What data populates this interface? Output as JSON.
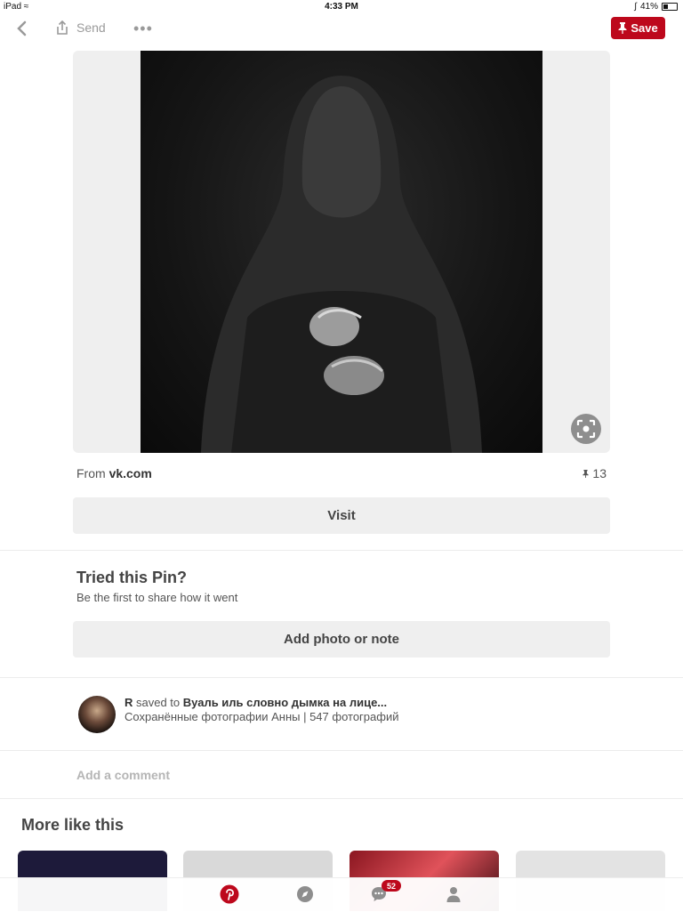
{
  "status_bar": {
    "device": "iPad",
    "time": "4:33 PM",
    "battery_percent": "41%"
  },
  "toolbar": {
    "send_label": "Send",
    "save_label": "Save"
  },
  "pin": {
    "source_prefix": "From ",
    "source_domain": "vk.com",
    "save_count": "13",
    "visit_label": "Visit"
  },
  "tried": {
    "title": "Tried this Pin?",
    "subtitle": "Be the first to share how it went",
    "add_label": "Add photo or note"
  },
  "saved_by": {
    "user": "R",
    "action": " saved to ",
    "board": "Вуаль иль словно дымка на лице...",
    "detail": "Сохранённые фотографии Анны | 547 фотографий"
  },
  "comment": {
    "placeholder": "Add a comment"
  },
  "more_like_this": {
    "title": "More like this"
  },
  "tabbar": {
    "messages_badge": "52"
  },
  "colors": {
    "brand_red": "#bd081c",
    "button_bg": "#efefef"
  }
}
